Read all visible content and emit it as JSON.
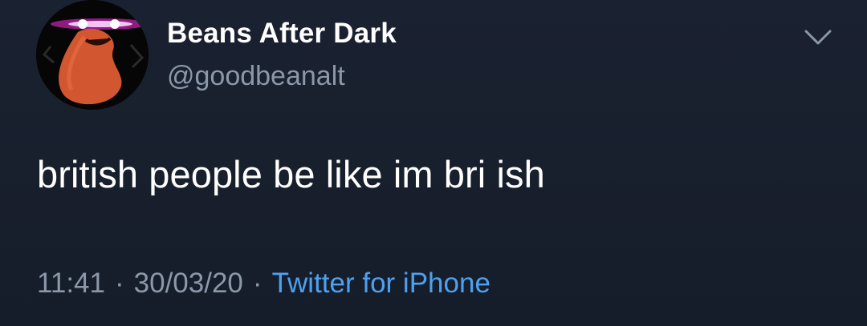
{
  "author": {
    "display_name": "Beans After Dark",
    "handle": "@goodbeanalt",
    "avatar_icon": "bean-with-glowing-eyes-icon"
  },
  "menu": {
    "icon": "chevron-down-icon"
  },
  "tweet": {
    "text": "british people be like im bri ish"
  },
  "meta": {
    "time": "11:41",
    "separator": "·",
    "date": "30/03/20",
    "source": "Twitter for iPhone"
  },
  "colors": {
    "background": "#181f2c",
    "name": "#ffffff",
    "secondary_text": "#8b98a8",
    "link": "#4ea1f0",
    "bean": "#d2562f",
    "glow": "#ff3cf0"
  }
}
